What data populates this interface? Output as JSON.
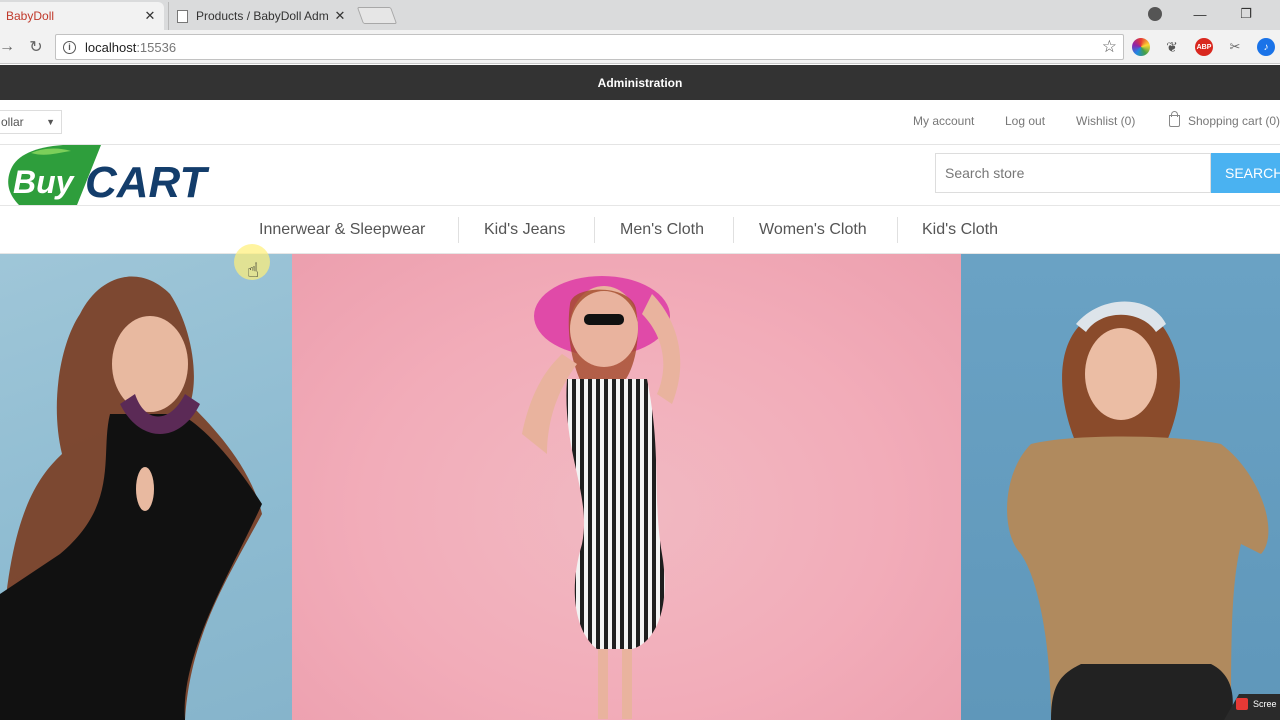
{
  "browser": {
    "tabs": [
      {
        "title": "BabyDoll",
        "active": true
      },
      {
        "title": "Products / BabyDoll Adm",
        "active": false
      }
    ],
    "url_host": "localhost",
    "url_port": ":15536",
    "extensions": [
      "color-picker",
      "leaf",
      "ABP",
      "tool",
      "blue"
    ]
  },
  "admin_bar": {
    "label": "Administration"
  },
  "header": {
    "currency": "ollar",
    "links": {
      "my_account": "My account",
      "logout": "Log out",
      "wishlist": "Wishlist (0)",
      "cart": "Shopping cart (0)"
    }
  },
  "logo": {
    "part1": "Buy",
    "part2": "CART"
  },
  "search": {
    "placeholder": "Search store",
    "button": "SEARCH"
  },
  "menu": [
    "Innerwear & Sleepwear",
    "Kid's Jeans",
    "Men's Cloth",
    "Women's Cloth",
    "Kid's Cloth"
  ],
  "colors": {
    "admin_bar": "#333333",
    "search_button": "#4ab2f1",
    "logo_green": "#2e9e3c",
    "logo_navy": "#133d6b"
  }
}
